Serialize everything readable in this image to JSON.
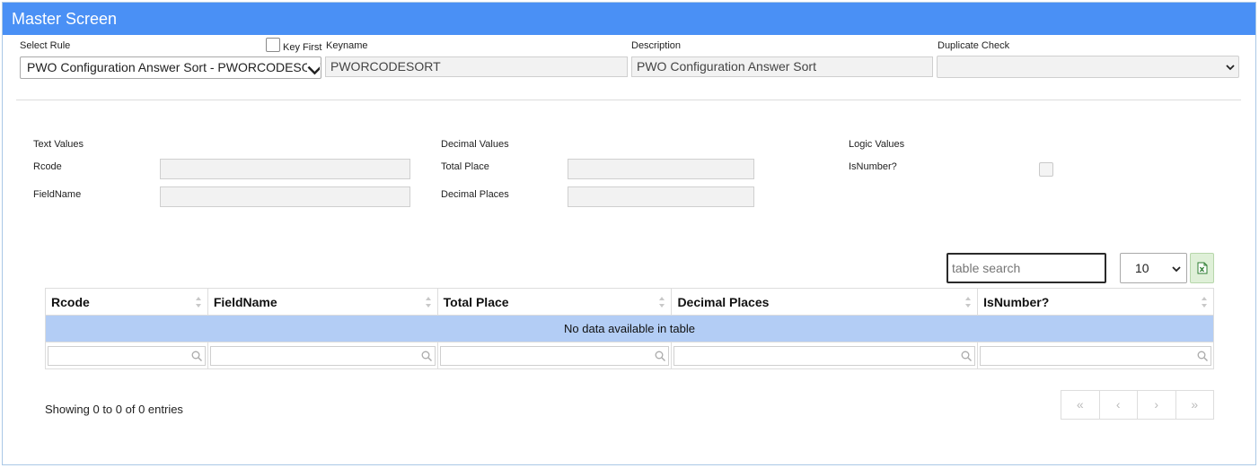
{
  "header": {
    "title": "Master Screen"
  },
  "top_form": {
    "select_rule_label": "Select Rule",
    "select_rule_value": "PWO Configuration Answer Sort - PWORCODESORT",
    "key_first_label": "Key First",
    "keyname_label": "Keyname",
    "keyname_value": "PWORCODESORT",
    "description_label": "Description",
    "description_value": "PWO Configuration Answer Sort",
    "duplicate_check_label": "Duplicate Check",
    "duplicate_check_value": ""
  },
  "sections": {
    "text_values": {
      "heading": "Text Values",
      "rcode_label": "Rcode",
      "fieldname_label": "FieldName"
    },
    "decimal_values": {
      "heading": "Decimal Values",
      "total_place_label": "Total Place",
      "decimal_places_label": "Decimal Places"
    },
    "logic_values": {
      "heading": "Logic Values",
      "isnumber_label": "IsNumber?"
    }
  },
  "table": {
    "search_placeholder": "table search",
    "page_length": "10",
    "columns": [
      "Rcode",
      "FieldName",
      "Total Place",
      "Decimal Places",
      "IsNumber?"
    ],
    "empty_message": "No data available in table",
    "info": "Showing 0 to 0 of 0 entries",
    "pager": [
      "«",
      "‹",
      "›",
      "»"
    ]
  },
  "icons": {
    "excel": "excel-export-icon",
    "sort": "sort-icon",
    "search": "magnifier-icon"
  },
  "colors": {
    "header_bg": "#4a90f5",
    "empty_row_bg": "#b3cdf5",
    "excel_btn_bg": "#dff0d8"
  }
}
